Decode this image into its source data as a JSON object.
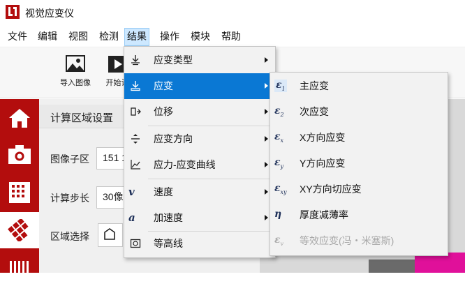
{
  "app": {
    "title": "视觉应变仪",
    "brand_color": "#b30d0d",
    "logo_icon": "app-logo-icon"
  },
  "menubar": {
    "items": [
      {
        "label": "文件"
      },
      {
        "label": "编辑"
      },
      {
        "label": "视图"
      },
      {
        "label": "检测"
      },
      {
        "label": "结果",
        "active": true
      },
      {
        "label": "操作"
      },
      {
        "label": "模块"
      },
      {
        "label": "帮助"
      }
    ]
  },
  "toolbar": {
    "buttons": [
      {
        "label": "导入图像",
        "icon": "image-import-icon"
      },
      {
        "label": "开始计",
        "icon": "play-icon"
      }
    ]
  },
  "sidebar": {
    "items": [
      {
        "icon": "home-icon"
      },
      {
        "icon": "camera-icon"
      },
      {
        "icon": "grid-icon"
      },
      {
        "icon": "mesh-icon",
        "selected": true
      },
      {
        "icon": "bars-icon"
      }
    ]
  },
  "panel": {
    "title": "计算区域设置",
    "rows": [
      {
        "label": "图像子区",
        "value": "151 1"
      },
      {
        "label": "计算步长",
        "value": "30像"
      },
      {
        "label": "区域选择",
        "value": ""
      }
    ]
  },
  "results_menu": {
    "items": [
      {
        "label": "应变类型",
        "icon": "strain-type-icon",
        "submenu": true
      },
      {
        "label": "应变",
        "icon": "strain-icon",
        "submenu": true,
        "highlighted": true
      },
      {
        "label": "位移",
        "icon": "displacement-icon",
        "submenu": true
      },
      {
        "label": "应变方向",
        "icon": "strain-direction-icon",
        "submenu": true
      },
      {
        "label": "应力-应变曲线",
        "icon": "stress-strain-curve-icon",
        "submenu": true
      },
      {
        "label": "速度",
        "icon": "velocity-icon",
        "glyph": "v",
        "submenu": true
      },
      {
        "label": "加速度",
        "icon": "acceleration-icon",
        "glyph": "a",
        "submenu": true
      },
      {
        "label": "等高线",
        "icon": "contour-icon",
        "submenu": false
      }
    ]
  },
  "strain_submenu": {
    "items": [
      {
        "label": "主应变",
        "symbol": "ε",
        "sub": "1",
        "enabled": true
      },
      {
        "label": "次应变",
        "symbol": "ε",
        "sub": "2",
        "enabled": true
      },
      {
        "label": "X方向应变",
        "symbol": "ε",
        "sub": "x",
        "enabled": true
      },
      {
        "label": "Y方向应变",
        "symbol": "ε",
        "sub": "y",
        "enabled": true
      },
      {
        "label": "XY方向切应变",
        "symbol": "ε",
        "sub": "xy",
        "enabled": true
      },
      {
        "label": "厚度减薄率",
        "symbol": "η",
        "sub": "",
        "enabled": true
      },
      {
        "label": "等效应变(冯・米塞斯)",
        "symbol": "ε",
        "sub": "v",
        "enabled": false
      }
    ]
  },
  "colors": {
    "highlight": "#0a78d4",
    "menu_bg": "#f2f2f2",
    "canvas_accent": "#e0109a"
  }
}
